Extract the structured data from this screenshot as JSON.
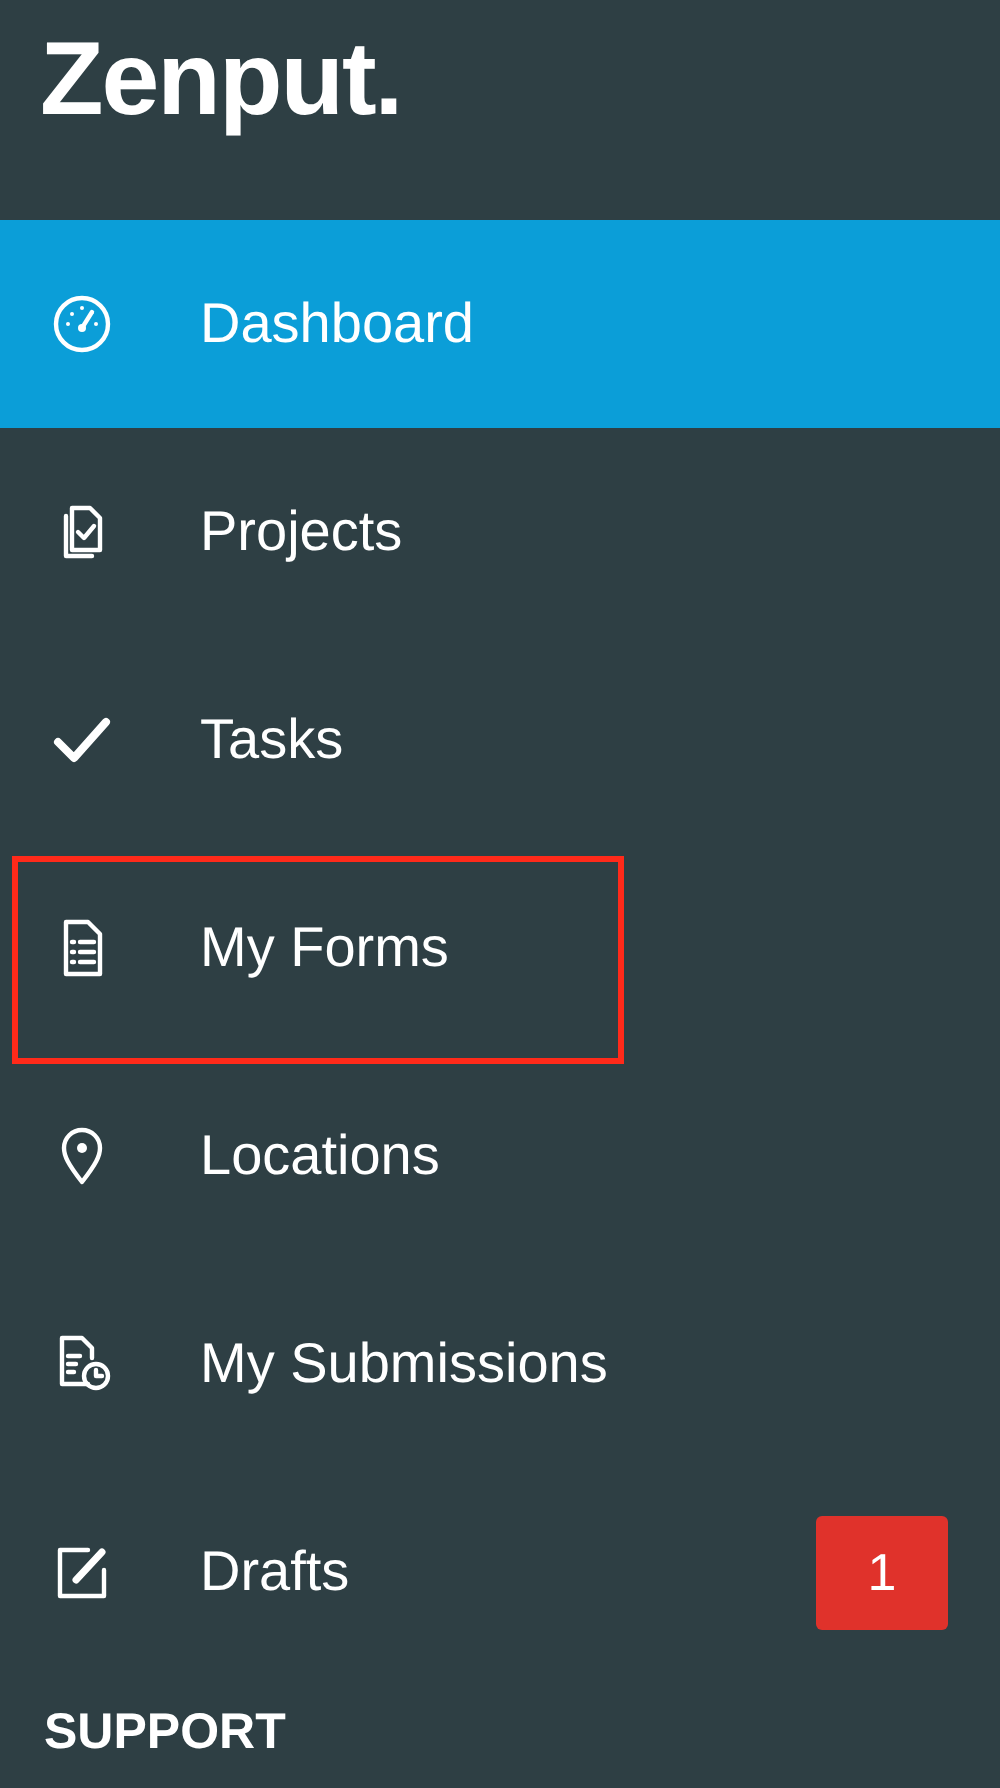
{
  "logo": "Zenput.",
  "nav_items": [
    {
      "label": "Dashboard",
      "selected": true,
      "highlighted": false
    },
    {
      "label": "Projects",
      "selected": false,
      "highlighted": false
    },
    {
      "label": "Tasks",
      "selected": false,
      "highlighted": false
    },
    {
      "label": "My Forms",
      "selected": false,
      "highlighted": true
    },
    {
      "label": "Locations",
      "selected": false,
      "highlighted": false
    },
    {
      "label": "My Submissions",
      "selected": false,
      "highlighted": false
    },
    {
      "label": "Drafts",
      "selected": false,
      "highlighted": false,
      "badge": "1"
    }
  ],
  "section_heading": "SUPPORT"
}
